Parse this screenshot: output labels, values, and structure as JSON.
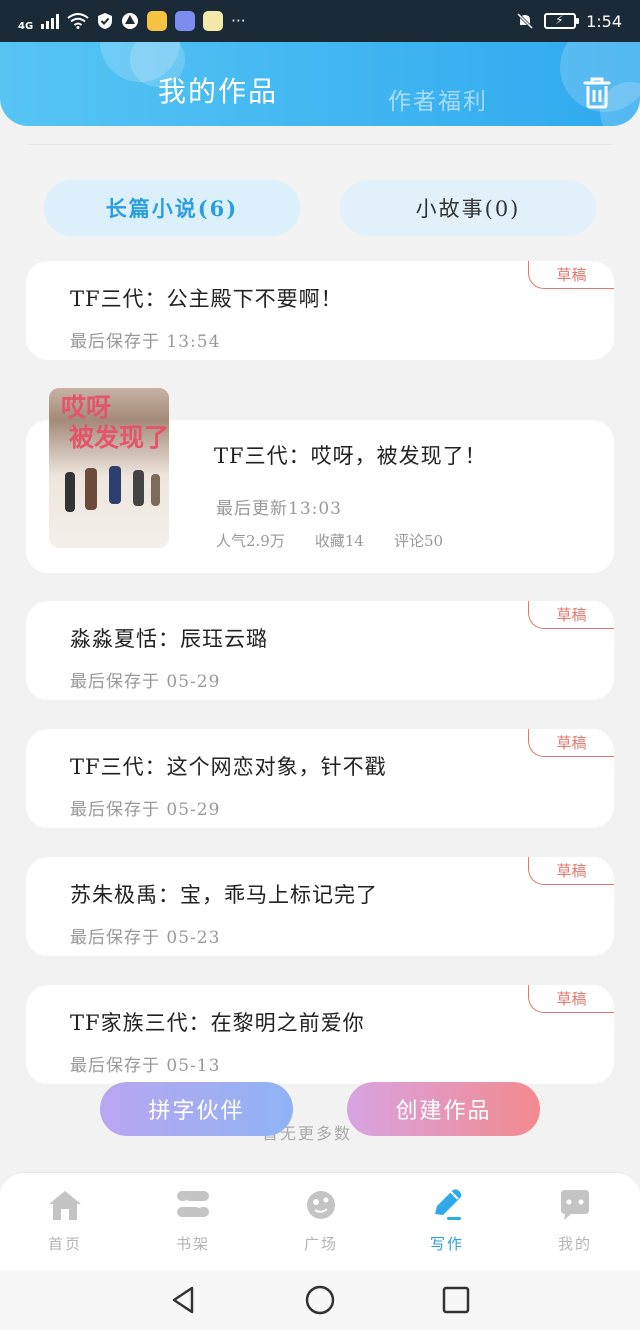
{
  "status_bar": {
    "network": "4G",
    "time": "1:54",
    "apps": [
      "weibo-app",
      "music-app",
      "wechat-app"
    ],
    "more": "···"
  },
  "header": {
    "tab_active": "我的作品",
    "tab_inactive": "作者福利"
  },
  "categories": {
    "novel_label": "长篇小说(6)",
    "story_label": "小故事(0)"
  },
  "works": [
    {
      "title": "TF三代：公主殿下不要啊！",
      "meta": "最后保存于 13:54",
      "tag": "草稿"
    },
    {
      "title": "TF三代：哎呀，被发现了！",
      "meta": "最后更新13:03",
      "popularity": "人气2.9万",
      "favorites": "收藏14",
      "comments": "评论50",
      "cover_text_1": "哎呀",
      "cover_text_2": "被发现了"
    },
    {
      "title": "淼淼夏恬：辰珏云璐",
      "meta": "最后保存于 05-29",
      "tag": "草稿"
    },
    {
      "title": "TF三代：这个网恋对象，针不戳",
      "meta": "最后保存于 05-29",
      "tag": "草稿"
    },
    {
      "title": "苏朱极禹：宝，乖马上标记完了",
      "meta": "最后保存于 05-23",
      "tag": "草稿"
    },
    {
      "title": "TF家族三代：在黎明之前爱你",
      "meta": "最后保存于 05-13",
      "tag": "草稿"
    }
  ],
  "footer": {
    "no_more": "暂无更多数",
    "partner_button": "拼字伙伴",
    "create_button": "创建作品"
  },
  "bottom_nav": [
    {
      "label": "首页",
      "icon": "home-icon"
    },
    {
      "label": "书架",
      "icon": "bookshelf-icon"
    },
    {
      "label": "广场",
      "icon": "planet-icon"
    },
    {
      "label": "写作",
      "icon": "pen-icon",
      "active": true
    },
    {
      "label": "我的",
      "icon": "chat-icon"
    }
  ],
  "colors": {
    "accent": "#2a9ee0",
    "header_start": "#56c5f4",
    "header_end": "#2fa9ee",
    "draft": "#e6776f"
  }
}
